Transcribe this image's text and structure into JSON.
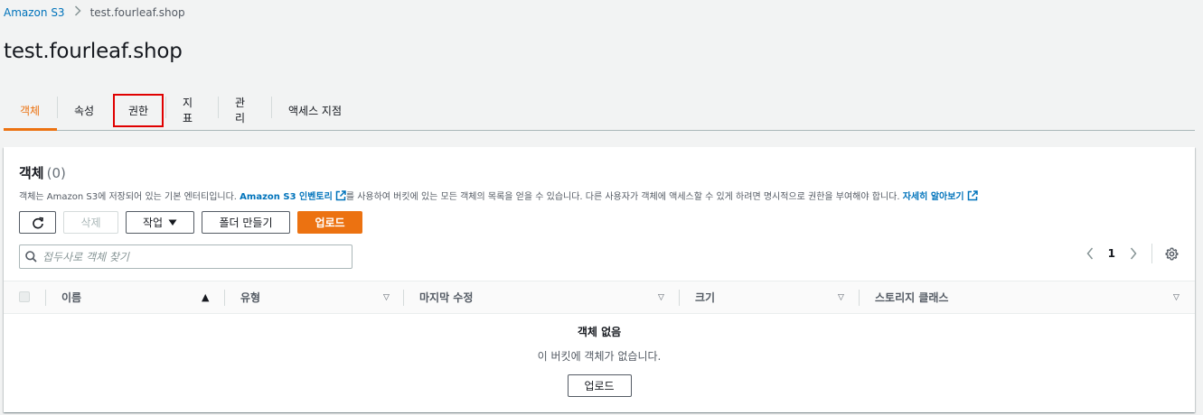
{
  "breadcrumb": {
    "root": "Amazon S3",
    "current": "test.fourleaf.shop"
  },
  "page": {
    "title": "test.fourleaf.shop"
  },
  "tabs": [
    {
      "label": "객체",
      "active": true
    },
    {
      "label": "속성",
      "active": false
    },
    {
      "label": "권한",
      "active": false,
      "highlighted": true
    },
    {
      "label": "지표",
      "active": false
    },
    {
      "label": "관리",
      "active": false
    },
    {
      "label": "액세스 지점",
      "active": false
    }
  ],
  "objects_panel": {
    "title": "객체",
    "count": "(0)",
    "description_prefix": "객체는 Amazon S3에 저장되어 있는 기본 엔터티입니다.",
    "inventory_link": "Amazon S3 인벤토리",
    "description_middle": "를 사용하여 버킷에 있는 모든 객체의 목록을 얻을 수 있습니다. 다른 사용자가 객체에 액세스할 수 있게 하려면 명시적으로 권한을 부여해야 합니다.",
    "learn_more_link": "자세히 알아보기"
  },
  "toolbar": {
    "delete_label": "삭제",
    "actions_label": "작업",
    "create_folder_label": "폴더 만들기",
    "upload_label": "업로드"
  },
  "search": {
    "placeholder": "접두사로 객체 찾기"
  },
  "pagination": {
    "current_page": "1"
  },
  "table": {
    "columns": [
      "이름",
      "유형",
      "마지막 수정",
      "크기",
      "스토리지 클래스"
    ]
  },
  "empty_state": {
    "title": "객체 없음",
    "description": "이 버킷에 객체가 없습니다.",
    "button_label": "업로드"
  },
  "colors": {
    "accent": "#ec7211",
    "link": "#0073bb",
    "highlight_border": "#e00000"
  },
  "icons": [
    "chevron-right-icon",
    "refresh-icon",
    "caret-down-icon",
    "external-link-icon",
    "search-icon",
    "chevron-left-icon",
    "gear-icon",
    "sort-asc-icon",
    "sort-desc-icon"
  ]
}
